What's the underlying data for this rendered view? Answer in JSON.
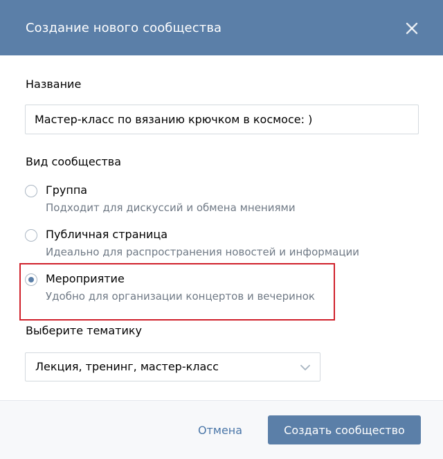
{
  "dialog": {
    "title": "Создание нового сообщества",
    "close_icon": "close-icon"
  },
  "form": {
    "name_label": "Название",
    "name_value": "Мастер-класс по вязанию крючком в космосе: )",
    "type_label": "Вид сообщества",
    "types": [
      {
        "title": "Группа",
        "description": "Подходит для дискуссий и обмена мнениями",
        "selected": false
      },
      {
        "title": "Публичная страница",
        "description": "Идеально для распространения новостей и информации",
        "selected": false
      },
      {
        "title": "Мероприятие",
        "description": "Удобно для организации концертов и вечеринок",
        "selected": true
      }
    ],
    "theme_label": "Выберите тематику",
    "theme_value": "Лекция, тренинг, мастер-класс",
    "theme_icon": "chevron-down-icon"
  },
  "footer": {
    "cancel_label": "Отмена",
    "submit_label": "Создать сообщество"
  },
  "colors": {
    "header_bg": "#5b7fa8",
    "accent": "#4a76a8",
    "highlight": "#d0202a",
    "muted_text": "#6f7985"
  }
}
